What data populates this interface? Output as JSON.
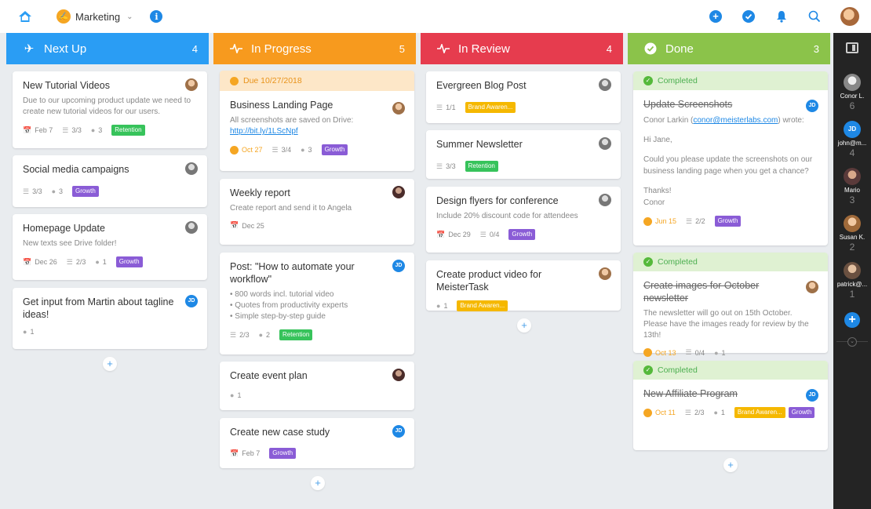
{
  "header": {
    "project_name": "Marketing",
    "icons": [
      "home-icon",
      "megaphone-icon",
      "chevron-down-icon",
      "info-icon",
      "add-icon",
      "check-icon",
      "bell-icon",
      "search-icon",
      "user-avatar"
    ]
  },
  "colors": {
    "next_up": "#2a9df4",
    "in_progress": "#f79a1e",
    "in_review": "#e63c4e",
    "done": "#8bc34a",
    "retention_tag": "#37c35b",
    "growth_tag": "#8a5cd6",
    "brand_tag": "#f5b800",
    "accent": "#1e88e5"
  },
  "columns": [
    {
      "name": "Next Up",
      "count": "4",
      "icon": "plane-icon",
      "cards": [
        {
          "title": "New Tutorial Videos",
          "desc": "Due to our upcoming product update we need to create new tutorial videos for our users.",
          "date": "Feb 7",
          "checklist": "3/3",
          "comments": "3",
          "tags": [
            "Retention"
          ],
          "avatar": "photo"
        },
        {
          "title": "Social media campaigns",
          "checklist": "3/3",
          "comments": "3",
          "tags": [
            "Growth"
          ],
          "avatar": "gray"
        },
        {
          "title": "Homepage Update",
          "desc": "New texts see Drive folder!",
          "date": "Dec 26",
          "checklist": "2/3",
          "comments": "1",
          "tags": [
            "Growth"
          ],
          "avatar": "gray"
        },
        {
          "title": "Get input from Martin about tagline ideas!",
          "comments": "1",
          "avatar": "JD"
        }
      ]
    },
    {
      "name": "In Progress",
      "count": "5",
      "icon": "activity-icon",
      "cards": [
        {
          "due_band": "Due 10/27/2018",
          "title": "Business Landing Page",
          "desc": "All screenshots are saved on Drive:",
          "link": "http://bit.ly/1LScNpf",
          "date": "Oct 27",
          "checklist": "3/4",
          "comments": "3",
          "tags": [
            "Growth"
          ],
          "avatar": "photo"
        },
        {
          "title": "Weekly report",
          "desc": "Create report and send it to Angela",
          "date": "Dec 25",
          "avatar": "dark"
        },
        {
          "title": "Post: \"How to automate your workflow\"",
          "bullets": [
            "800 words incl. tutorial video",
            "Quotes from productivity experts",
            "Simple step-by-step guide"
          ],
          "checklist": "2/3",
          "comments": "2",
          "tags": [
            "Retention"
          ],
          "avatar": "JD"
        },
        {
          "title": "Create event plan",
          "comments": "1",
          "avatar": "dark"
        },
        {
          "title": "Create new case study",
          "date": "Feb 7",
          "tags": [
            "Growth"
          ],
          "avatar": "JD"
        }
      ]
    },
    {
      "name": "In Review",
      "count": "4",
      "icon": "activity-icon",
      "cards": [
        {
          "title": "Evergreen Blog Post",
          "checklist": "1/1",
          "tags": [
            "Brand Awaren..."
          ],
          "avatar": "gray"
        },
        {
          "title": "Summer Newsletter",
          "checklist": "3/3",
          "tags": [
            "Retention"
          ],
          "avatar": "gray"
        },
        {
          "title": "Design flyers for conference",
          "desc": "Include 20% discount code for attendees",
          "date": "Dec 29",
          "checklist": "0/4",
          "tags": [
            "Growth"
          ],
          "avatar": "gray"
        },
        {
          "title": "Create product video for MeisterTask",
          "comments": "1",
          "tags": [
            "Brand Awaren..."
          ],
          "avatar": "photo"
        }
      ]
    },
    {
      "name": "Done",
      "count": "3",
      "icon": "check-circle-icon",
      "cards": [
        {
          "completed": "Completed",
          "title": "Update Screenshots",
          "desc_author": "Conor Larkin",
          "desc_email": "conor@meisterlabs.com",
          "desc_wrote": "wrote:",
          "greeting": "Hi Jane,",
          "body": "Could you please update the screenshots on our business landing page when you get a chance?",
          "thanks": "Thanks!",
          "signoff": "Conor",
          "date": "Jun 15",
          "checklist": "2/2",
          "tags": [
            "Growth"
          ],
          "avatar": "JD"
        },
        {
          "completed": "Completed",
          "title": "Create images for October newsletter",
          "desc": "The newsletter will go out on 15th October. Please have the images ready for review by the 13th!",
          "date": "Oct 13",
          "checklist": "0/4",
          "comments": "1",
          "avatar": "photo"
        },
        {
          "completed": "Completed",
          "title": "New Affiliate Program",
          "date": "Oct 11",
          "checklist": "2/3",
          "comments": "1",
          "tags": [
            "Brand Awaren...",
            "Growth"
          ],
          "avatar": "JD"
        }
      ]
    }
  ],
  "sidebar": {
    "users": [
      {
        "name": "Conor L.",
        "count": "6"
      },
      {
        "name": "john@m...",
        "count": "4",
        "initials": "JD"
      },
      {
        "name": "Mario",
        "count": "3"
      },
      {
        "name": "Susan K.",
        "count": "2"
      },
      {
        "name": "patrick@...",
        "count": "1"
      }
    ]
  },
  "add_label": "+"
}
